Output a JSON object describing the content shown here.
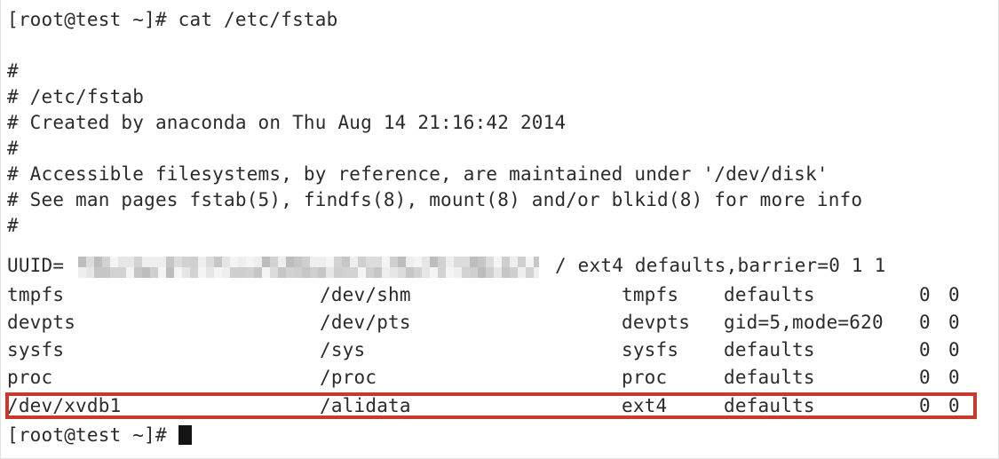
{
  "terminal": {
    "prompt": "[root@test ~]# ",
    "command": "cat /etc/fstab",
    "trailing_prompt": "[root@test ~]# ",
    "colors": {
      "background": "#ffffff",
      "text": "#2b2b2b",
      "highlight_box": "#c9392f",
      "cursor": "#141414",
      "redaction": "#c8c8c8"
    },
    "comment_lines": [
      "#",
      "# /etc/fstab",
      "# Created by anaconda on Thu Aug 14 21:16:42 2014",
      "#",
      "# Accessible filesystems, by reference, are maintained under '/dev/disk'",
      "# See man pages fstab(5), findfs(8), mount(8) and/or blkid(8) for more info",
      "#"
    ],
    "uuid_line": {
      "prefix": "UUID=",
      "value_redacted": true,
      "mountpoint": "/",
      "fstype": "ext4",
      "options": "defaults,barrier=0",
      "dump": "1",
      "pass": "1",
      "tail": "/ ext4 defaults,barrier=0 1 1"
    },
    "fstab_rows": [
      {
        "device": "tmpfs",
        "mountpoint": "/dev/shm",
        "fstype": "tmpfs",
        "options": "defaults",
        "dump": "0",
        "pass": "0",
        "highlighted": false
      },
      {
        "device": "devpts",
        "mountpoint": "/dev/pts",
        "fstype": "devpts",
        "options": "gid=5,mode=620",
        "dump": "0",
        "pass": "0",
        "highlighted": false
      },
      {
        "device": "sysfs",
        "mountpoint": "/sys",
        "fstype": "sysfs",
        "options": "defaults",
        "dump": "0",
        "pass": "0",
        "highlighted": false
      },
      {
        "device": "proc",
        "mountpoint": "/proc",
        "fstype": "proc",
        "options": "defaults",
        "dump": "0",
        "pass": "0",
        "highlighted": false
      },
      {
        "device": "/dev/xvdb1",
        "mountpoint": "/alidata",
        "fstype": "ext4",
        "options": "defaults",
        "dump": "0",
        "pass": "0",
        "highlighted": true
      }
    ]
  }
}
